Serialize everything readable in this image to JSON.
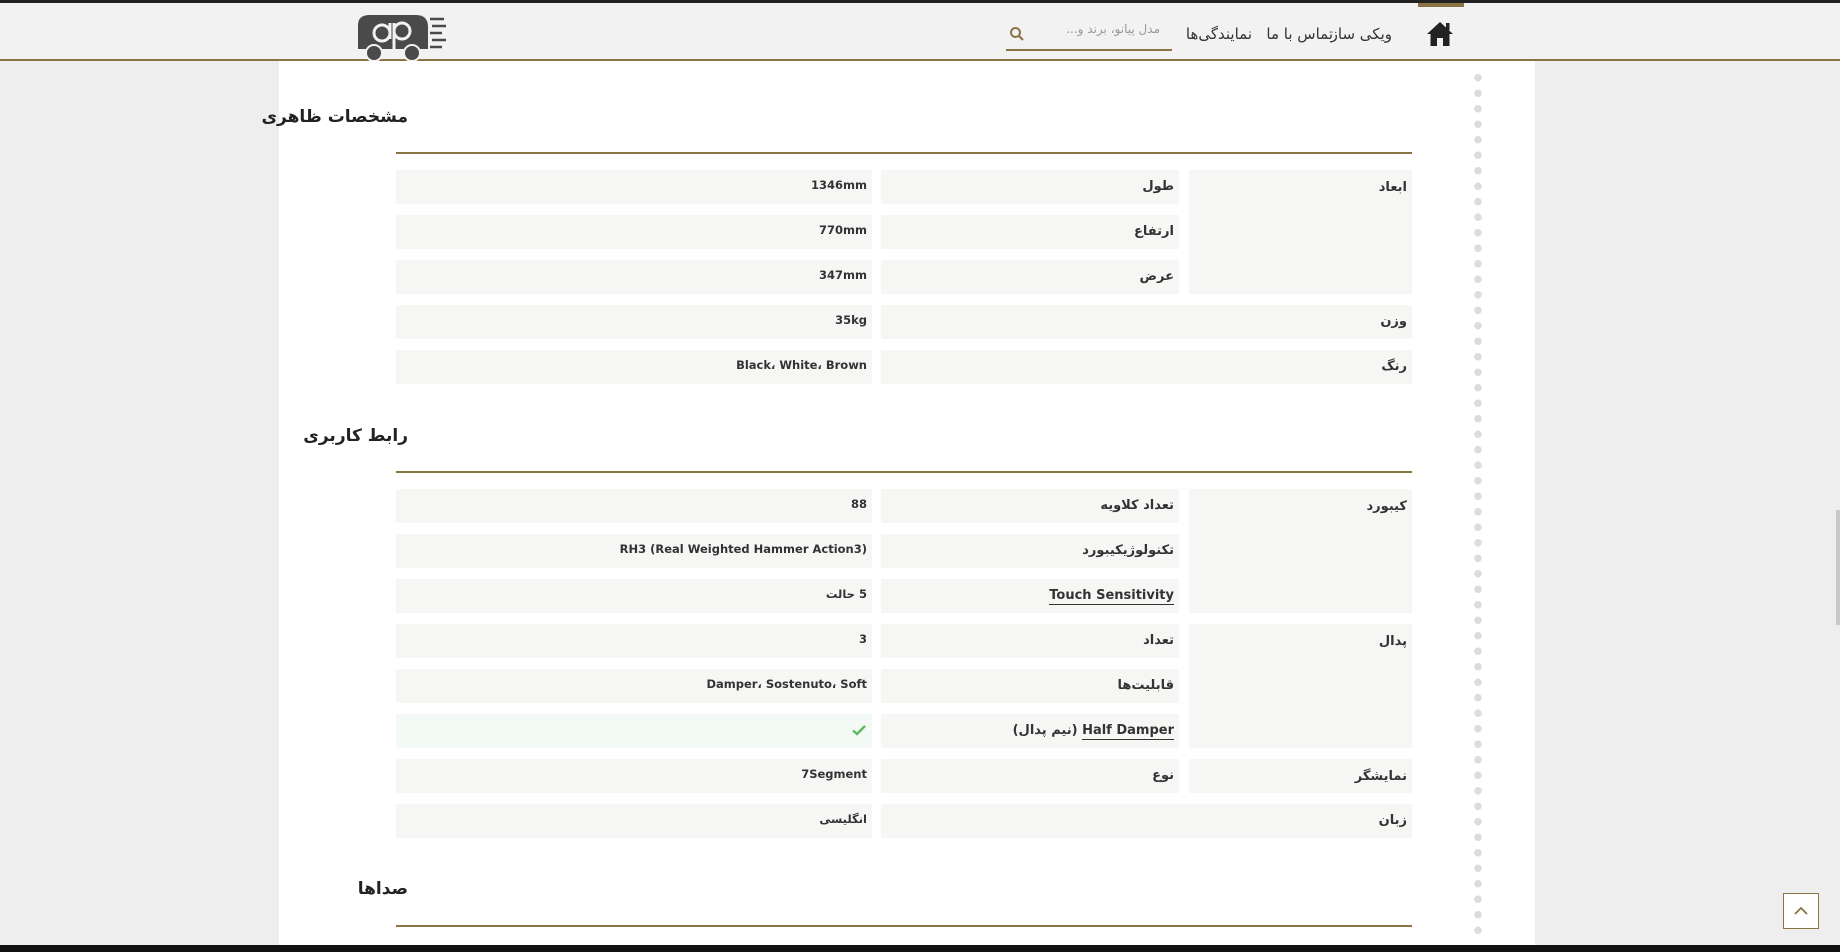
{
  "header": {
    "nav": {
      "wiki": "ویکی ساز",
      "contact": "تماس با ما",
      "dealers": "نمایندگی‌ها"
    },
    "search": {
      "placeholder": "مدل پیانو، برند و..."
    },
    "brand_color": "#8a7444"
  },
  "sections": {
    "appearance": {
      "title": "مشخصات ظاهری",
      "dimensions": {
        "label": "ابعاد",
        "length": {
          "label": "طول",
          "value": "1346mm"
        },
        "height": {
          "label": "ارتفاع",
          "value": "770mm"
        },
        "width": {
          "label": "عرض",
          "value": "347mm"
        }
      },
      "weight": {
        "label": "وزن",
        "value": "35kg"
      },
      "color": {
        "label": "رنگ",
        "value": "Black، White، Brown"
      }
    },
    "interface": {
      "title": "رابط کاربری",
      "keyboard": {
        "label": "کیبورد",
        "keys": {
          "label": "تعداد کلاویه",
          "value": "88"
        },
        "technology": {
          "label": "تکنولوژیکیبورد",
          "value": "(RH3 (Real Weighted Hammer Action3"
        },
        "touch": {
          "label": "Touch Sensitivity",
          "value": "5 حالت"
        }
      },
      "pedal": {
        "label": "پدال",
        "count": {
          "label": "تعداد",
          "value": "3"
        },
        "features": {
          "label": "قابلیت‌ها",
          "value": "Damper، Sostenuto، Soft"
        },
        "half_damper": {
          "term": "Half Damper",
          "suffix": " (نیم پدال)",
          "value_icon": "check-icon"
        }
      },
      "display": {
        "label": "نمایشگر",
        "type": {
          "label": "نوع",
          "value": "7Segment"
        }
      },
      "language": {
        "label": "زبان",
        "value": "انگلیسی"
      }
    },
    "sounds": {
      "title": "صداها"
    }
  }
}
